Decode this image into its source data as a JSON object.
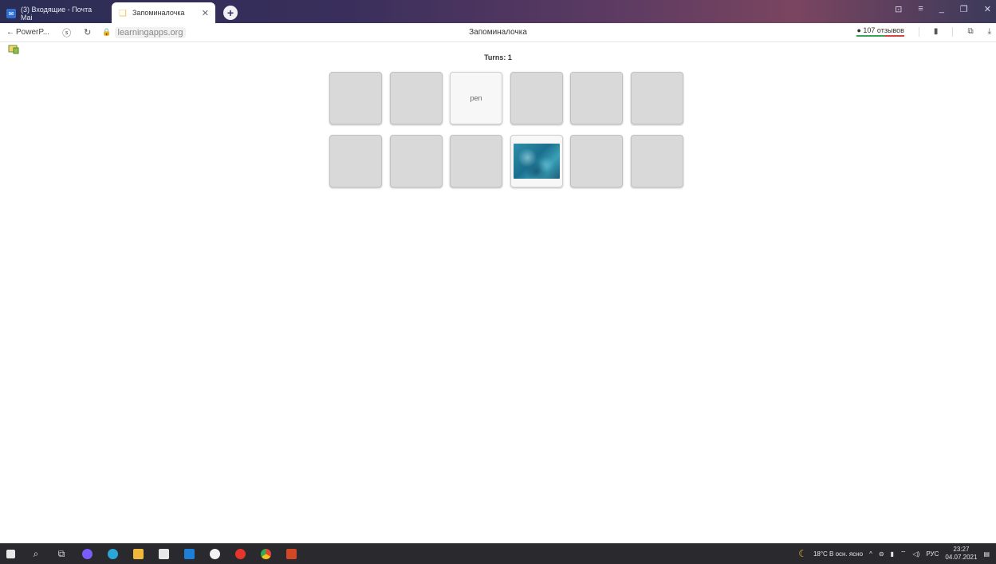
{
  "browser": {
    "tabs": [
      {
        "label": "(3) Входящие - Почта Mai",
        "active": false
      },
      {
        "label": "Запоминалочка",
        "active": true
      }
    ],
    "new_tab": "+",
    "back_label": "PowerP...",
    "url_host": "learningapps.org",
    "page_title": "Запоминалочка",
    "reviews": "107 отзывов"
  },
  "game": {
    "turns_label": "Turns: 1",
    "cards_row1": [
      {
        "state": "closed",
        "text": ""
      },
      {
        "state": "closed",
        "text": ""
      },
      {
        "state": "open",
        "text": "pen"
      },
      {
        "state": "closed",
        "text": ""
      },
      {
        "state": "closed",
        "text": ""
      },
      {
        "state": "closed",
        "text": ""
      }
    ],
    "cards_row2": [
      {
        "state": "closed",
        "text": ""
      },
      {
        "state": "closed",
        "text": ""
      },
      {
        "state": "closed",
        "text": ""
      },
      {
        "state": "open-image",
        "image": "underwater-photo"
      },
      {
        "state": "closed",
        "text": ""
      },
      {
        "state": "closed",
        "text": ""
      }
    ]
  },
  "taskbar": {
    "weather": "18°C В осн. ясно",
    "lang": "РУС",
    "time": "23:27",
    "date": "04.07.2021"
  },
  "colors": {
    "card_closed": "#d9d9d9",
    "card_open": "#f7f7f7",
    "taskbar": "#2a2a2e"
  }
}
